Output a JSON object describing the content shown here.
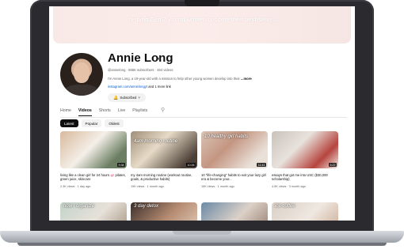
{
  "banner": {
    "text": "helping Gen Z young women become their best selves"
  },
  "channel": {
    "name": "Annie Long",
    "verified_icon": "verified-check-icon",
    "meta": "@annielong · 666K subscribers · 464 videos",
    "description": "I'm Annie Long, a 19-year-old with a mission to help other young women develop into their",
    "more": "...more",
    "link": "instagram.com/annielongyt",
    "links_more": "and 1 more link",
    "subscribe_label": "Subscribed",
    "subscribe_caret": "˅"
  },
  "tabs": [
    {
      "label": "Home"
    },
    {
      "label": "Videos"
    },
    {
      "label": "Shorts"
    },
    {
      "label": "Live"
    },
    {
      "label": "Playlists"
    }
  ],
  "chips": [
    {
      "label": "Latest"
    },
    {
      "label": "Popular"
    },
    {
      "label": "Oldest"
    }
  ],
  "videos": [
    {
      "title": "living like a clean girl for 24 hours 🧼 pilates, green juice, skincare",
      "meta": "2.3K views · 1 day ago",
      "duration": "9:38",
      "overlay": ""
    },
    {
      "title": "my 4am morning routine (workout routine, goals, & productive habits)",
      "meta": "19K views · 1 month ago",
      "duration": "10:26",
      "overlay": "4am morning routine"
    },
    {
      "title": "10 \"life-changing\" habits to exit your lazy girl era & become your...",
      "meta": "16K views · 1 month ago",
      "duration": "11:41",
      "overlay": "10 healthy girl habits"
    },
    {
      "title": "essays that got me into USC ($30,000 scholarship)",
      "meta": "4.5K views · 3 month ago",
      "duration": "6:22",
      "overlay": ""
    }
  ],
  "bottom_row": [
    {
      "overlay": "how I organize"
    },
    {
      "overlay": "3 day detox"
    },
    {
      "overlay": ""
    },
    {
      "overlay": "ice coffee"
    }
  ],
  "icons": {
    "bell": "bell-icon",
    "search": "search-icon"
  }
}
